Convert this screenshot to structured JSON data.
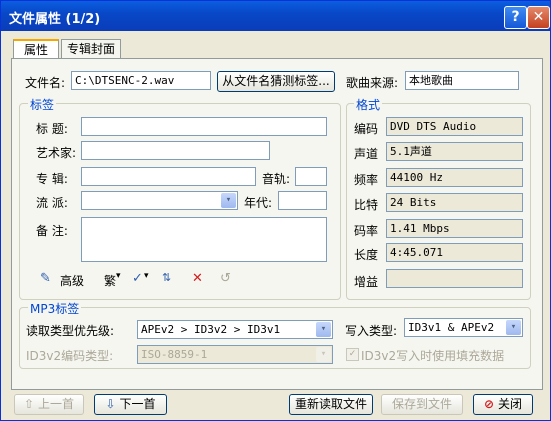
{
  "window": {
    "title": "文件属性 (1/2)",
    "help_label": "?",
    "close_label": "✕"
  },
  "tabs": [
    {
      "label": "属性",
      "active": true
    },
    {
      "label": "专辑封面",
      "active": false
    }
  ],
  "file": {
    "label": "文件名:",
    "value": "C:\\DTSENC-2.wav",
    "guess_button": "从文件名猜测标签...",
    "source_label": "歌曲来源:",
    "source_value": "本地歌曲"
  },
  "tags_group": {
    "title": "标签",
    "title_label": "标  题:",
    "title_value": "",
    "artist_label": "艺术家:",
    "artist_value": "",
    "album_label": "专  辑:",
    "album_value": "",
    "track_label": "音轨:",
    "track_value": "",
    "genre_label": "流  派:",
    "genre_value": "",
    "year_label": "年代:",
    "year_value": "",
    "comment_label": "备  注:",
    "comment_value": "",
    "toolbar": {
      "advanced_label": "高级",
      "traditional_label": "繁",
      "dropdown_glyph": "▾"
    }
  },
  "format_group": {
    "title": "格式",
    "rows": [
      {
        "label": "编码",
        "value": "DVD DTS Audio"
      },
      {
        "label": "声道",
        "value": "5.1声道"
      },
      {
        "label": "频率",
        "value": "44100 Hz"
      },
      {
        "label": "比特",
        "value": "24 Bits"
      },
      {
        "label": "码率",
        "value": "1.41 Mbps"
      },
      {
        "label": "长度",
        "value": "4:45.071"
      },
      {
        "label": "增益",
        "value": ""
      }
    ]
  },
  "mp3_group": {
    "title": "MP3标签",
    "read_priority_label": "读取类型优先级:",
    "read_priority_value": "APEv2 > ID3v2 > ID3v1",
    "write_type_label": "写入类型:",
    "write_type_value": "ID3v1 & APEv2",
    "id3v2_encoding_label": "ID3v2编码类型:",
    "id3v2_encoding_value": "ISO-8859-1",
    "padding_checkbox_label": "ID3v2写入时使用填充数据",
    "padding_checked": true
  },
  "footer": {
    "prev_label": "上一首",
    "next_label": "下一首",
    "reread_label": "重新读取文件",
    "save_label": "保存到文件",
    "close_label": "关闭"
  }
}
